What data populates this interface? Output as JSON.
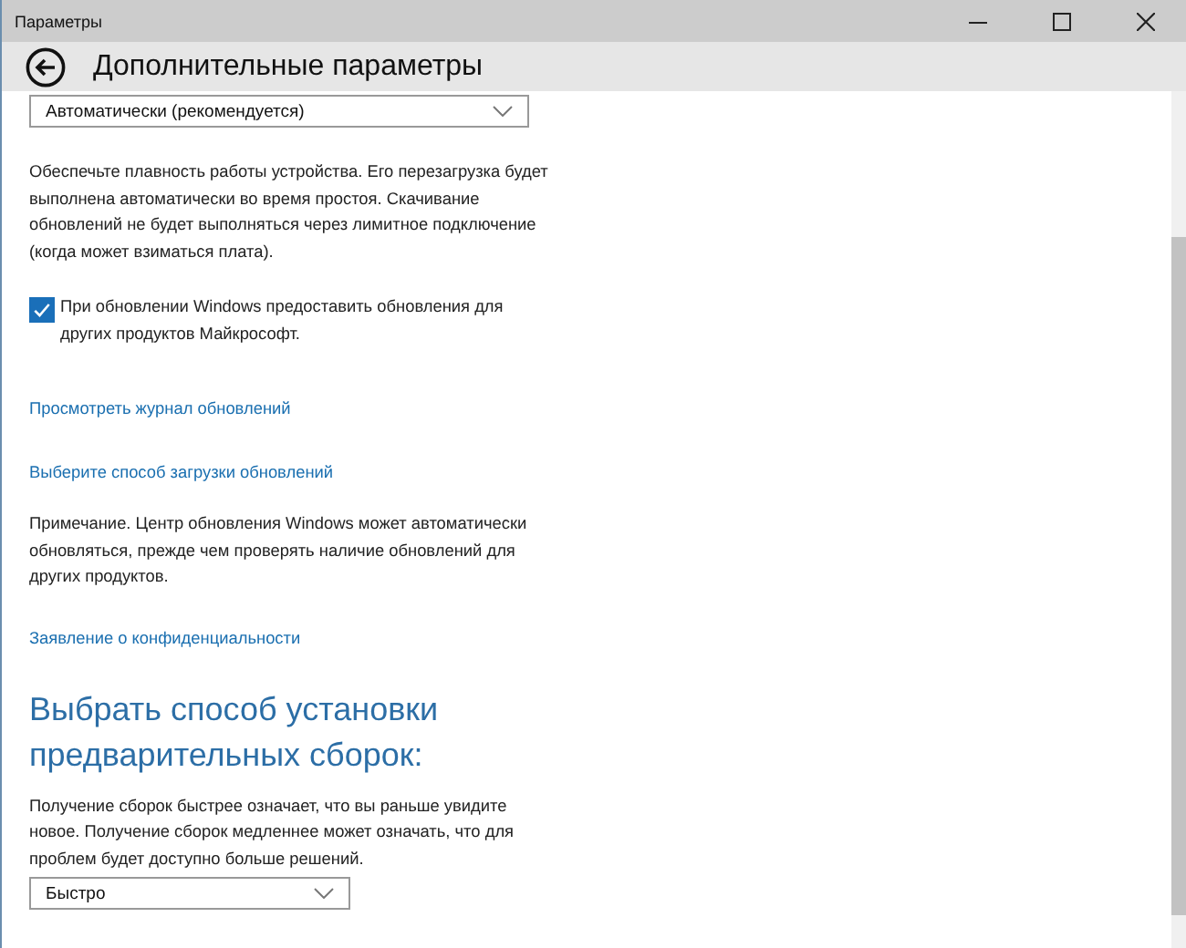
{
  "window": {
    "title": "Параметры"
  },
  "header": {
    "title": "Дополнительные параметры"
  },
  "content": [
    {
      "kind": "dropdown",
      "value": "Автоматически (рекомендуется)"
    },
    {
      "kind": "paragraph",
      "text": "Обеспечьте плавность работы устройства. Его перезагрузка будет выполнена автоматически во время простоя. Скачивание обновлений не будет выполняться через лимитное подключение (когда может взиматься плата)."
    },
    {
      "kind": "checkbox",
      "label": "При обновлении Windows предоставить обновления для других продуктов Майкрософт.",
      "checked": true
    },
    {
      "kind": "link",
      "text": "Просмотреть журнал обновлений"
    },
    {
      "kind": "link",
      "text": "Выберите способ загрузки обновлений"
    },
    {
      "kind": "paragraph",
      "text": "Примечание. Центр обновления Windows может автоматически обновляться, прежде чем проверять наличие обновлений для других продуктов."
    },
    {
      "kind": "link",
      "text": "Заявление о конфиденциальности"
    },
    {
      "kind": "heading",
      "text": "Выбрать способ установки предварительных сборок:"
    },
    {
      "kind": "paragraph",
      "text": "Получение сборок быстрее означает, что вы раньше увидите новое. Получение сборок медленнее может означать, что для проблем будет доступно больше решений."
    },
    {
      "kind": "dropdown",
      "value": "Быстро"
    }
  ]
}
